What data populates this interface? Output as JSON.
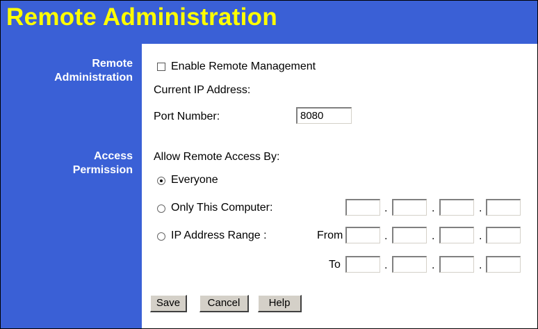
{
  "page": {
    "title": "Remote Administration",
    "colors": {
      "background": "#3a60d6",
      "title": "#ffff00",
      "panel": "#ffffff"
    }
  },
  "remote_admin": {
    "label_line1": "Remote",
    "label_line2": "Administration",
    "enable_label": "Enable Remote Management",
    "enable_checked": false,
    "current_ip_label": "Current IP Address:",
    "port_label": "Port Number:",
    "port_value": "8080"
  },
  "access": {
    "label_line1": "Access",
    "label_line2": "Permission",
    "allow_label": "Allow Remote Access By:",
    "option_everyone": "Everyone",
    "option_only_this": "Only This Computer:",
    "option_range": "IP Address Range :",
    "from_label": "From",
    "to_label": "To",
    "selected": "Everyone"
  },
  "buttons": {
    "save": "Save",
    "cancel": "Cancel",
    "help": "Help"
  }
}
